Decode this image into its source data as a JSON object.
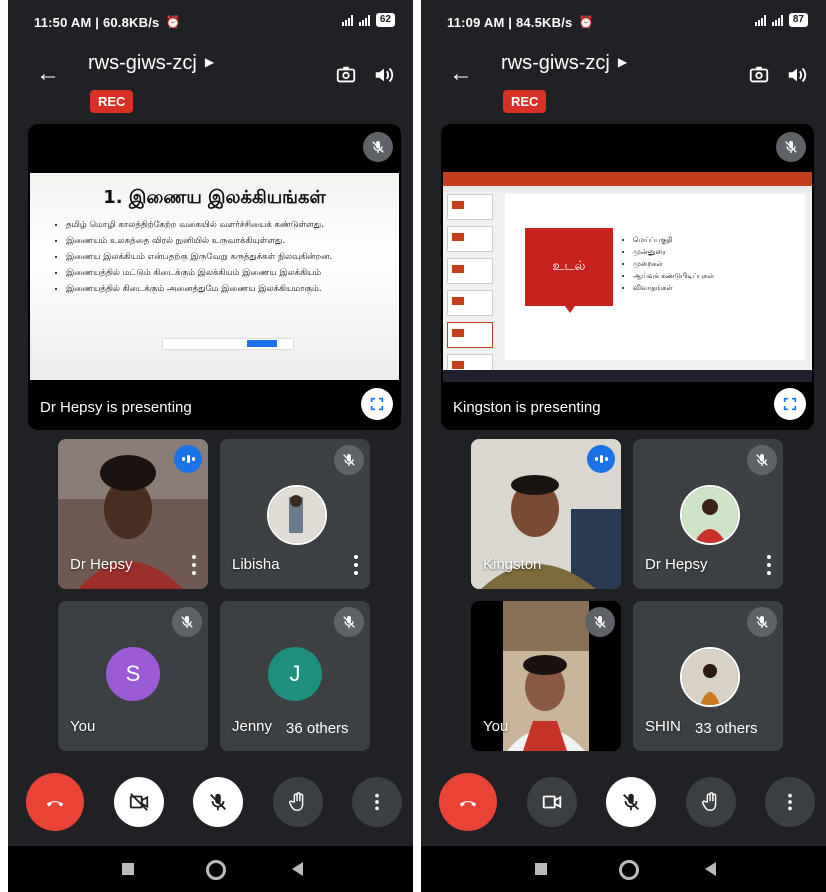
{
  "colors": {
    "bg": "#202124",
    "tile": "#3c4043",
    "end_call": "#ea4335",
    "rec": "#d93025",
    "speaking": "#1a73e8",
    "slide_red": "#c8221e"
  },
  "phones": [
    {
      "status": {
        "time": "11:50 AM | 60.8KB/s",
        "battery": "62"
      },
      "meeting_code": "rws-giws-zcj",
      "rec": "REC",
      "presenting_label": "Dr Hepsy is presenting",
      "slide": {
        "title": "1. இணைய இலக்கியங்கள்",
        "bullets": [
          "தமிழ் மொழி காலத்திற்கேற்ற வகையில் வளர்ச்சியைக் கண்டுள்ளது.",
          "இணையம் உலகத்தை விரல் நுனியில் உருவாக்கியுள்ளது.",
          "இணைய இலக்கியம் என்பதற்கு இருவேறு கருத்துக்கள் நிலவுகின்றன.",
          "இணையத்தில் மட்டும் கிடைக்கும் இலக்கியம் இணைய இலக்கியம்",
          "இணையத்தில் கிடைக்கும் அனைத்துமே இணைய இலக்கியமாகும்."
        ]
      },
      "tiles": [
        {
          "name": "Dr Hepsy",
          "state": "speaking"
        },
        {
          "name": "Libisha",
          "state": "muted"
        },
        {
          "name": "You",
          "state": "muted",
          "initial": "S",
          "color": "#9c5bd6"
        },
        {
          "name": "Jenny",
          "state": "muted",
          "initial": "J",
          "color": "#1e8e7e"
        }
      ],
      "others": "36 others",
      "controls": {
        "camera": "camera-off-icon",
        "mic": "mic-off-icon"
      }
    },
    {
      "status": {
        "time": "11:09 AM | 84.5KB/s",
        "battery": "87"
      },
      "meeting_code": "rws-giws-zcj",
      "rec": "REC",
      "presenting_label": "Kingston is presenting",
      "slide": {
        "box_text": "உடல்",
        "bullets": [
          "மெய்ப்பகுதி",
          "முன்னுரை",
          "முறைகள்",
          "ஆய்வுக் கண்டுபிடிப்புகள்",
          "விவாதங்கள்"
        ]
      },
      "tiles": [
        {
          "name": "Kingston",
          "state": "speaking"
        },
        {
          "name": "Dr Hepsy",
          "state": "muted"
        },
        {
          "name": "You",
          "state": "muted"
        },
        {
          "name": "SHINI S",
          "state": "muted"
        }
      ],
      "others": "33 others",
      "controls": {
        "camera": "camera-icon",
        "mic": "mic-off-icon"
      }
    }
  ]
}
